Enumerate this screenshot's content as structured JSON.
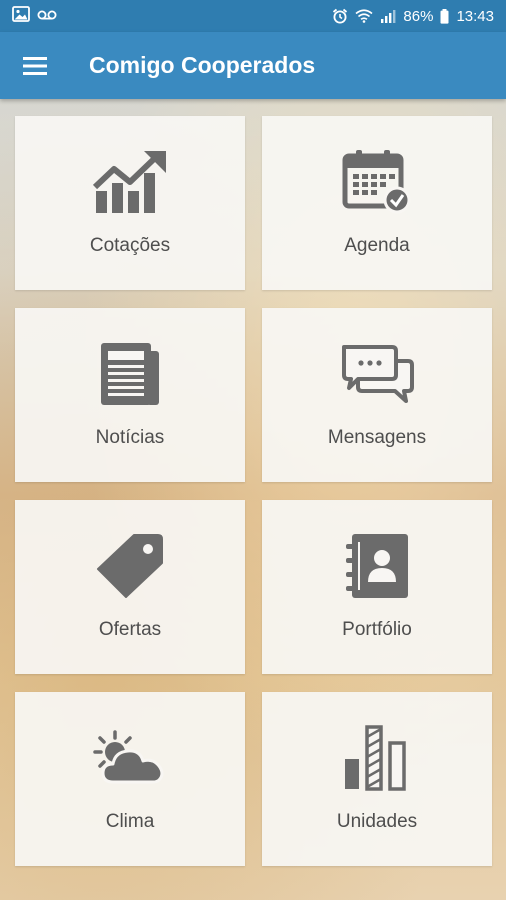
{
  "status_bar": {
    "icons_left": [
      "image-icon",
      "voicemail-icon"
    ],
    "icons_right": [
      "alarm-icon",
      "wifi-icon",
      "signal-icon"
    ],
    "battery_percent": "86%",
    "time": "13:43"
  },
  "app_bar": {
    "title": "Comigo Cooperados",
    "menu_icon": "hamburger-menu-icon"
  },
  "colors": {
    "status_bar": "#2f7db0",
    "app_bar": "#3a8ac0",
    "icon_gray": "#6b6b6b",
    "label_text": "#4e4e4e",
    "tile_bg": "#f8f6f3"
  },
  "tiles": [
    {
      "label": "Cotações",
      "icon": "chart-growth-icon"
    },
    {
      "label": "Agenda",
      "icon": "calendar-check-icon"
    },
    {
      "label": "Notícias",
      "icon": "newspaper-icon"
    },
    {
      "label": "Mensagens",
      "icon": "chat-bubbles-icon"
    },
    {
      "label": "Ofertas",
      "icon": "price-tag-icon"
    },
    {
      "label": "Portfólio",
      "icon": "contact-book-icon"
    },
    {
      "label": "Clima",
      "icon": "sun-cloud-icon"
    },
    {
      "label": "Unidades",
      "icon": "bar-units-icon"
    }
  ]
}
